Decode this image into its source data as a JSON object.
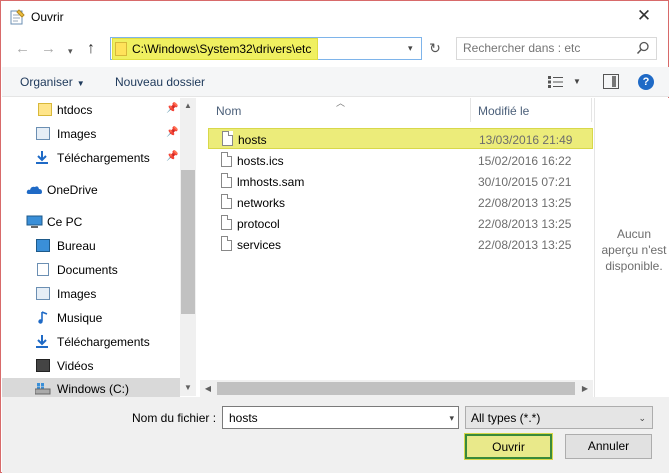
{
  "window": {
    "title": "Ouvrir",
    "close_glyph": "✕"
  },
  "address": {
    "path": "C:\\Windows\\System32\\drivers\\etc"
  },
  "search": {
    "placeholder": "Rechercher dans : etc"
  },
  "toolbar": {
    "organise_label": "Organiser",
    "new_folder_label": "Nouveau dossier",
    "help_label": "?"
  },
  "sidebar": {
    "items": [
      {
        "label": "htdocs",
        "icon": "folder-icon",
        "pinned": true
      },
      {
        "label": "Images",
        "icon": "pictures-icon",
        "pinned": true
      },
      {
        "label": "Téléchargements",
        "icon": "downloads-icon",
        "pinned": true
      },
      {
        "label": "OneDrive",
        "icon": "onedrive-icon",
        "pinned": false
      },
      {
        "label": "Ce PC",
        "icon": "computer-icon",
        "pinned": false
      },
      {
        "label": "Bureau",
        "icon": "desktop-icon",
        "pinned": false
      },
      {
        "label": "Documents",
        "icon": "documents-icon",
        "pinned": false
      },
      {
        "label": "Images",
        "icon": "pictures-icon",
        "pinned": false
      },
      {
        "label": "Musique",
        "icon": "music-icon",
        "pinned": false
      },
      {
        "label": "Téléchargements",
        "icon": "downloads-icon",
        "pinned": false
      },
      {
        "label": "Vidéos",
        "icon": "videos-icon",
        "pinned": false
      },
      {
        "label": "Windows (C:)",
        "icon": "drive-icon",
        "pinned": false,
        "selected": true
      }
    ]
  },
  "filelist": {
    "columns": {
      "name": "Nom",
      "modified": "Modifié le"
    },
    "files": [
      {
        "name": "hosts",
        "modified": "13/03/2016 21:49",
        "highlighted": true
      },
      {
        "name": "hosts.ics",
        "modified": "15/02/2016 16:22"
      },
      {
        "name": "lmhosts.sam",
        "modified": "30/10/2015 07:21"
      },
      {
        "name": "networks",
        "modified": "22/08/2013 13:25"
      },
      {
        "name": "protocol",
        "modified": "22/08/2013 13:25"
      },
      {
        "name": "services",
        "modified": "22/08/2013 13:25"
      }
    ]
  },
  "preview": {
    "message": "Aucun aperçu n'est disponible."
  },
  "bottom": {
    "filename_label": "Nom du fichier :",
    "filename_value": "hosts",
    "filetype_value": "All types (*.*)",
    "open_label": "Ouvrir",
    "cancel_label": "Annuler"
  },
  "colors": {
    "highlight": "#ecec7a",
    "accent_blue": "#1f6ac6",
    "open_border": "#3a8a3a"
  }
}
